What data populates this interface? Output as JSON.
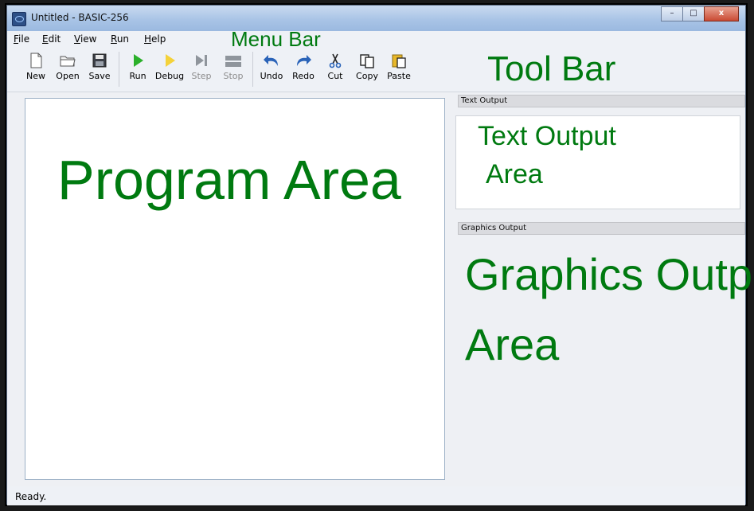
{
  "window": {
    "title": "Untitled - BASIC-256",
    "minimize": "–",
    "maximize": "□",
    "close": "x"
  },
  "menu": [
    {
      "label": "File"
    },
    {
      "label": "Edit"
    },
    {
      "label": "View"
    },
    {
      "label": "Run"
    },
    {
      "label": "Help"
    }
  ],
  "toolbar": [
    {
      "label": "New",
      "icon": "new-file-icon",
      "enabled": true
    },
    {
      "label": "Open",
      "icon": "folder-open-icon",
      "enabled": true
    },
    {
      "label": "Save",
      "icon": "floppy-disk-icon",
      "enabled": true
    },
    {
      "label": "Run",
      "icon": "play-icon",
      "enabled": true
    },
    {
      "label": "Debug",
      "icon": "debug-play-icon",
      "enabled": true
    },
    {
      "label": "Step",
      "icon": "step-icon",
      "enabled": false
    },
    {
      "label": "Stop",
      "icon": "stop-icon",
      "enabled": false
    },
    {
      "label": "Undo",
      "icon": "undo-arrow-icon",
      "enabled": true
    },
    {
      "label": "Redo",
      "icon": "redo-arrow-icon",
      "enabled": true
    },
    {
      "label": "Cut",
      "icon": "scissors-icon",
      "enabled": true
    },
    {
      "label": "Copy",
      "icon": "copy-icon",
      "enabled": true
    },
    {
      "label": "Paste",
      "icon": "paste-icon",
      "enabled": true
    }
  ],
  "panels": {
    "text_output_header": "Text Output",
    "graphics_output_header": "Graphics Output"
  },
  "annotations": {
    "menu_bar": "Menu Bar",
    "tool_bar": "Tool Bar",
    "program_area": "Program Area",
    "text_output_area_line1": "Text Output",
    "text_output_area_line2": "Area",
    "graphics_output_area_line1": "Graphics  Output",
    "graphics_output_area_line2": "Area"
  },
  "status": "Ready.",
  "colors": {
    "annotation": "#007a10",
    "run": "#2bb02b",
    "debug": "#f4d23a",
    "accent": "#2a63b8"
  }
}
